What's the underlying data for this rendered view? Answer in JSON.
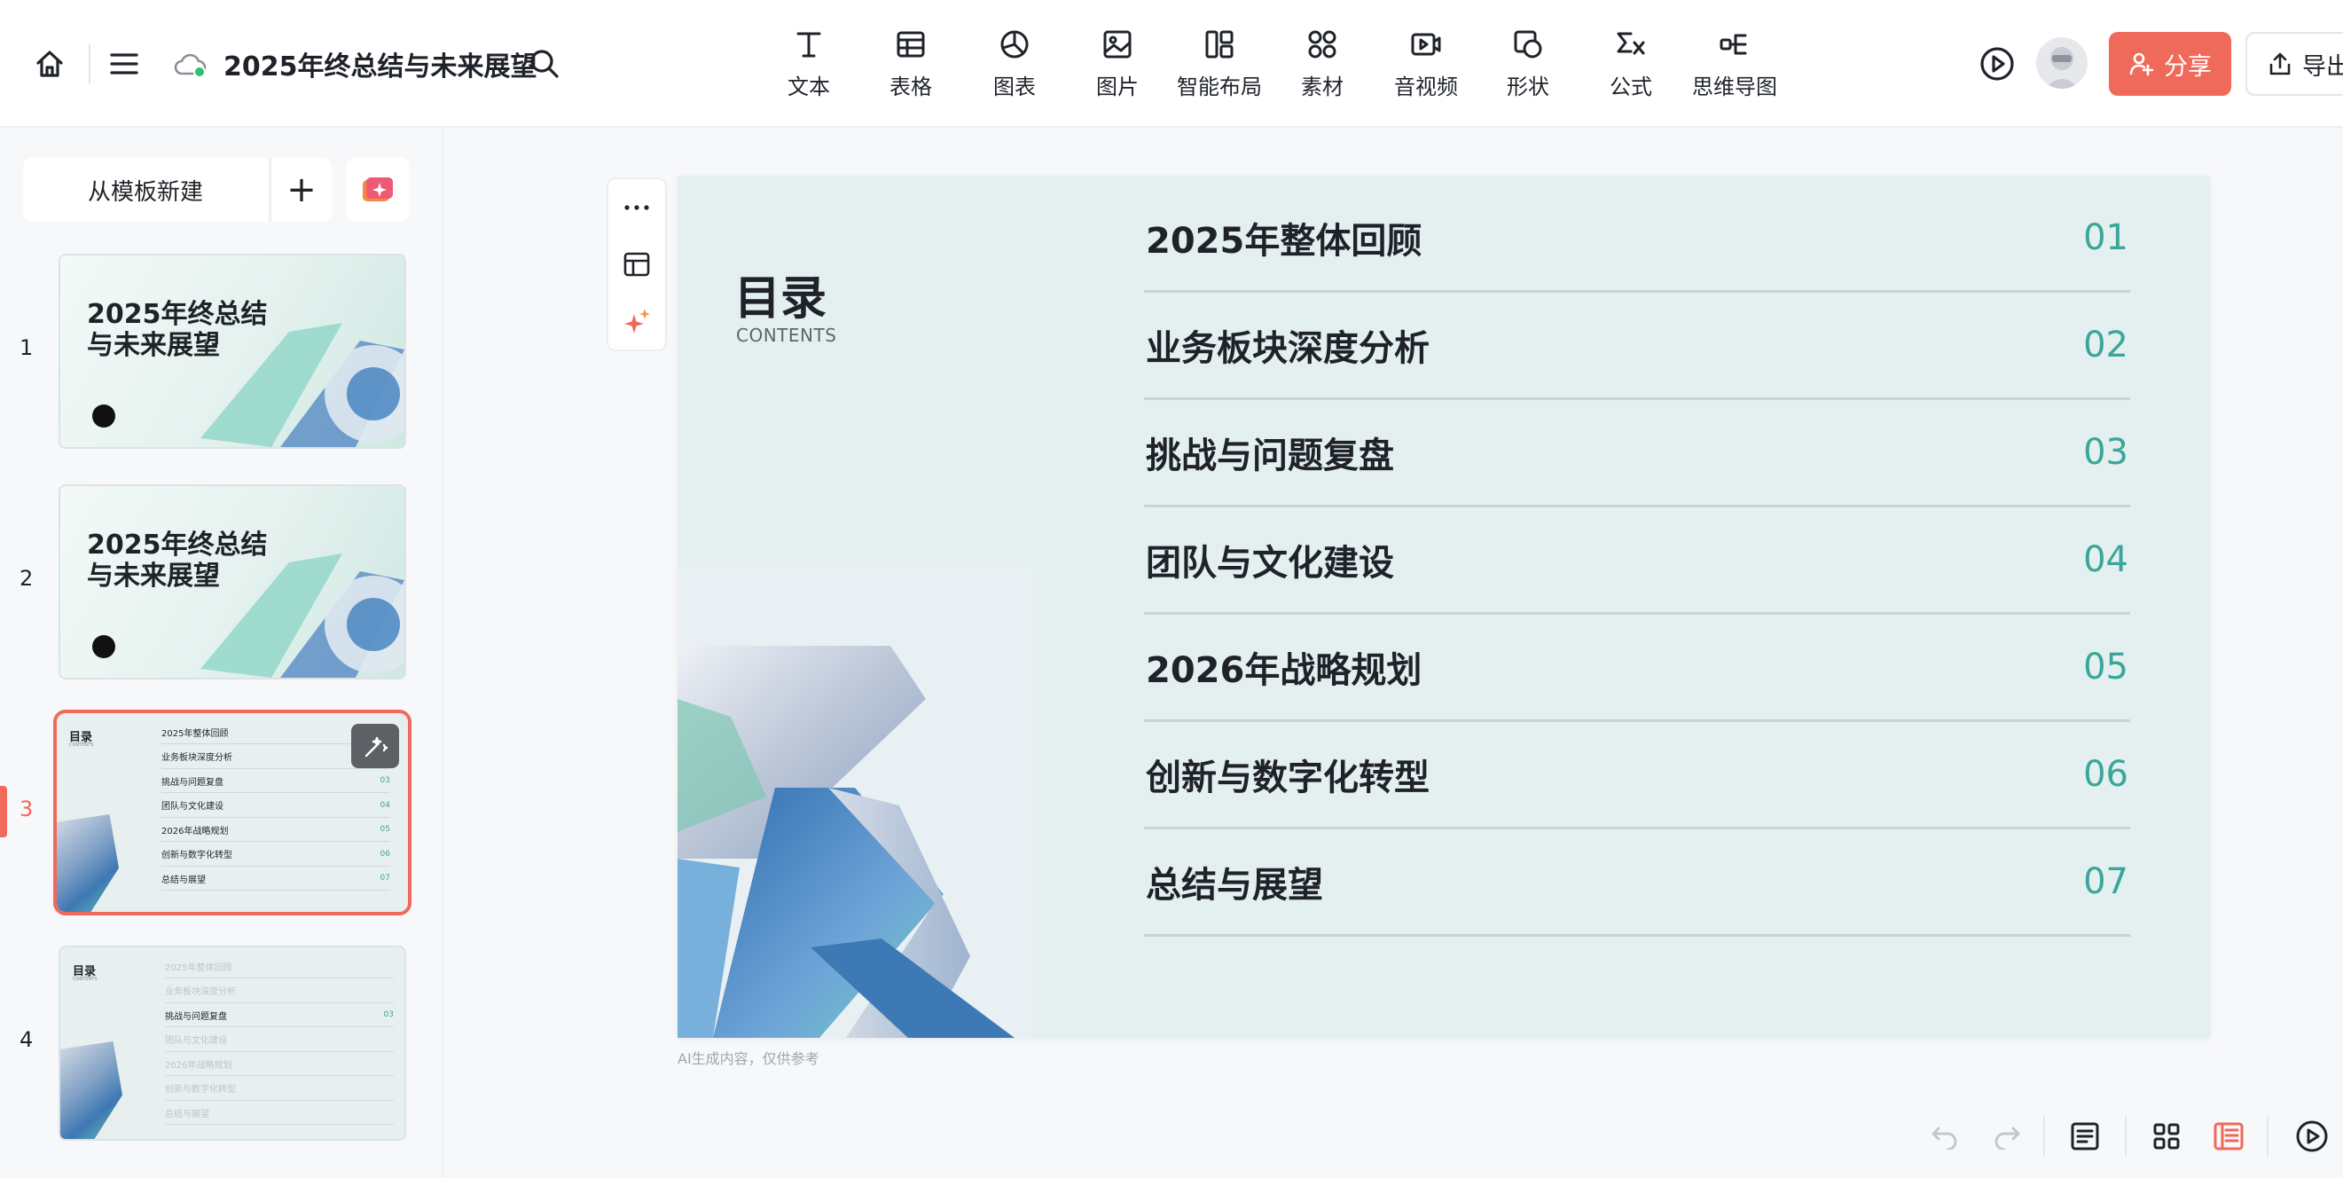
{
  "header": {
    "doc_title": "2025年终总结与未来展望",
    "tools": [
      {
        "label": "文本",
        "icon": "text-icon"
      },
      {
        "label": "表格",
        "icon": "table-icon"
      },
      {
        "label": "图表",
        "icon": "chart-icon"
      },
      {
        "label": "图片",
        "icon": "image-icon"
      },
      {
        "label": "智能布局",
        "icon": "smart-layout-icon"
      },
      {
        "label": "素材",
        "icon": "assets-icon"
      },
      {
        "label": "音视频",
        "icon": "media-icon"
      },
      {
        "label": "形状",
        "icon": "shape-icon"
      },
      {
        "label": "公式",
        "icon": "formula-icon"
      },
      {
        "label": "思维导图",
        "icon": "mindmap-icon"
      }
    ],
    "share_label": "分享",
    "export_label": "导出"
  },
  "sidebar": {
    "new_from_template": "从模板新建",
    "add_symbol": "+",
    "thumbnails": [
      {
        "number": "1",
        "title_line1": "2025年终总结",
        "title_line2": "与未来展望"
      },
      {
        "number": "2",
        "title_line1": "2025年终总结",
        "title_line2": "与未来展望"
      },
      {
        "number": "3",
        "title": "目录",
        "subtitle": "CONTENTS",
        "rows": [
          {
            "label": "2025年整体回顾",
            "num": ""
          },
          {
            "label": "业务板块深度分析",
            "num": ""
          },
          {
            "label": "挑战与问题复盘",
            "num": "03"
          },
          {
            "label": "团队与文化建设",
            "num": "04"
          },
          {
            "label": "2026年战略规划",
            "num": "05"
          },
          {
            "label": "创新与数字化转型",
            "num": "06"
          },
          {
            "label": "总结与展望",
            "num": "07"
          }
        ]
      },
      {
        "number": "4",
        "title": "目录",
        "subtitle": "CONTENTS",
        "rows": [
          {
            "label": "2025年整体回顾",
            "num": ""
          },
          {
            "label": "业务板块深度分析",
            "num": ""
          },
          {
            "label": "挑战与问题复盘",
            "num": "03"
          },
          {
            "label": "团队与文化建设",
            "num": ""
          },
          {
            "label": "2026年战略规划",
            "num": ""
          },
          {
            "label": "创新与数字化转型",
            "num": ""
          },
          {
            "label": "总结与展望",
            "num": ""
          }
        ]
      }
    ],
    "selected_index": 3
  },
  "slide": {
    "title": "目录",
    "subtitle": "CONTENTS",
    "items": [
      {
        "label": "2025年整体回顾",
        "num": "01"
      },
      {
        "label": "业务板块深度分析",
        "num": "02"
      },
      {
        "label": "挑战与问题复盘",
        "num": "03"
      },
      {
        "label": "团队与文化建设",
        "num": "04"
      },
      {
        "label": "2026年战略规划",
        "num": "05"
      },
      {
        "label": "创新与数字化转型",
        "num": "06"
      },
      {
        "label": "总结与展望",
        "num": "07"
      }
    ],
    "disclaimer": "AI生成内容，仅供参考"
  },
  "colors": {
    "accent": "#ef6a5a",
    "teal": "#3aa69a",
    "slide_bg": "#e4eff0"
  }
}
